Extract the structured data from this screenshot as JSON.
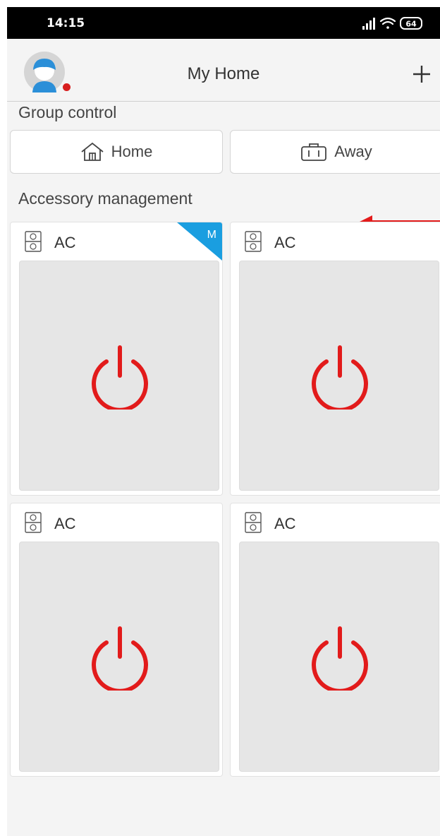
{
  "status_bar": {
    "time": "14:15",
    "battery": "64"
  },
  "header": {
    "title": "My Home"
  },
  "group_control": {
    "label": "Group control",
    "buttons": [
      {
        "label": "Home",
        "icon": "house-icon"
      },
      {
        "label": "Away",
        "icon": "suitcase-icon"
      }
    ]
  },
  "accessories": {
    "label": "Accessory management",
    "cards": [
      {
        "label": "AC",
        "badge": "M",
        "icon": "ac-unit-icon"
      },
      {
        "label": "AC",
        "icon": "ac-unit-icon"
      },
      {
        "label": "AC",
        "icon": "ac-unit-icon"
      },
      {
        "label": "AC",
        "icon": "ac-unit-icon"
      }
    ]
  },
  "colors": {
    "power": "#e21b1b",
    "badge": "#1a9ee0",
    "arrow": "#e31b1b",
    "avatar": "#2b8fd8",
    "notification_dot": "#d71e1e"
  }
}
